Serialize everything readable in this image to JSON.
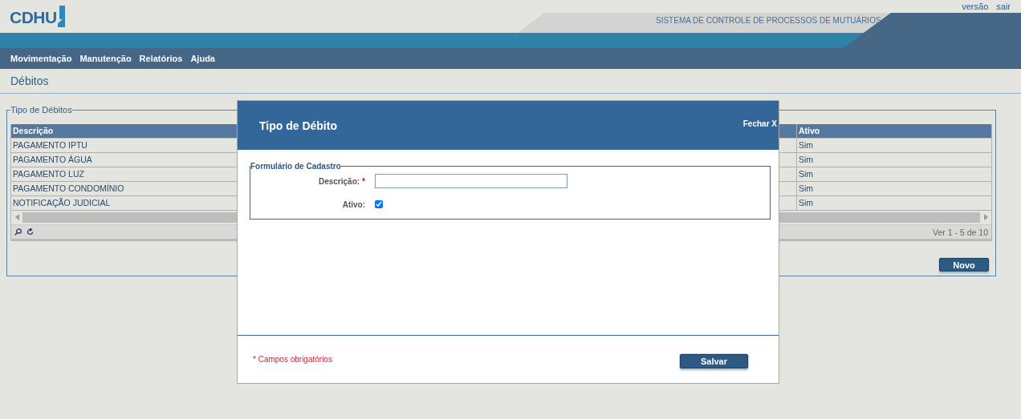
{
  "header": {
    "logo": "CDHU",
    "links": [
      "versão",
      "sair"
    ],
    "system_title": "SISTEMA DE CONTROLE DE PROCESSOS DE MUTUÁRIOS"
  },
  "menu": [
    "Movimentação",
    "Manutenção",
    "Relatórios",
    "Ajuda"
  ],
  "page_title": "Débitos",
  "grid": {
    "legend": "Tipo de Débitos",
    "columns": [
      "Descrição",
      "Ativo"
    ],
    "rows": [
      {
        "cells": [
          "PAGAMENTO IPTU",
          "Sim"
        ]
      },
      {
        "cells": [
          "PAGAMENTO ÁGUA",
          "Sim"
        ]
      },
      {
        "cells": [
          "PAGAMENTO LUZ",
          "Sim"
        ]
      },
      {
        "cells": [
          "PAGAMENTO CONDOMÍNIO",
          "Sim"
        ]
      },
      {
        "cells": [
          "NOTIFICAÇÃO JUDICIAL",
          "Sim"
        ]
      }
    ],
    "pager": "Ver 1 - 5 de 10",
    "new_button": "Novo"
  },
  "dialog": {
    "title": "Tipo de Débito",
    "close": "Fechar X",
    "legend": "Formulário de Cadastro",
    "fields": [
      {
        "kind": "text",
        "label": "Descrição:",
        "required_mark": "*"
      },
      {
        "kind": "checkbox",
        "label": "Ativo:",
        "checked": true
      }
    ],
    "footer_note": "* Campos obrigatórios",
    "save_button": "Salvar"
  }
}
